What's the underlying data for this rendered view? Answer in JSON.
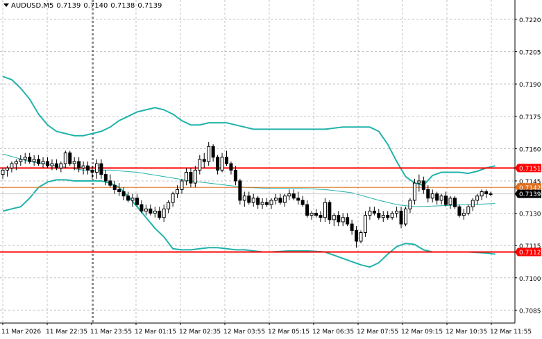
{
  "header": {
    "symbol": "AUDUSD,M5",
    "open": "0.7139",
    "high": "0.7140",
    "low": "0.7138",
    "close": "0.7139"
  },
  "colors": {
    "background": "#ffffff",
    "grid": "#c0c0c0",
    "candle": "#000000",
    "bands": "#20b2aa",
    "ma": "#20b2aa",
    "level_line": "#ff0000",
    "bid_line": "#e07020",
    "price_label": "#000000",
    "level_label": "#ff0000"
  },
  "chart_data": {
    "type": "candlestick",
    "y_ticks": [
      "0.7220",
      "0.7205",
      "0.7190",
      "0.7175",
      "0.7160",
      "0.7145",
      "0.7130",
      "0.7115",
      "0.7100",
      "0.7085"
    ],
    "x_ticks": [
      "11 Mar 2026",
      "11 Mar 22:35",
      "11 Mar 23:55",
      "12 Mar 01:15",
      "12 Mar 02:35",
      "12 Mar 03:55",
      "12 Mar 05:15",
      "12 Mar 06:35",
      "12 Mar 07:55",
      "12 Mar 09:15",
      "12 Mar 10:35",
      "12 Mar 11:55"
    ],
    "ylim": [
      0.7079,
      0.7229
    ],
    "levels": [
      {
        "value": 0.7151,
        "label": "0.7151"
      },
      {
        "value": 0.7112,
        "label": "0.7112"
      }
    ],
    "bid": {
      "value": 0.7142,
      "label": "0.7142"
    },
    "last_price": {
      "value": 0.7139,
      "label": "0.7139"
    },
    "grid": true,
    "period_separator": true,
    "bands_upper": [
      [
        0,
        0.71935
      ],
      [
        2,
        0.7192
      ],
      [
        4,
        0.7188
      ],
      [
        6,
        0.7183
      ],
      [
        8,
        0.7176
      ],
      [
        10,
        0.7171
      ],
      [
        12,
        0.7168
      ],
      [
        14,
        0.7167
      ],
      [
        16,
        0.7166
      ],
      [
        18,
        0.7166
      ],
      [
        20,
        0.7167
      ],
      [
        22,
        0.7168
      ],
      [
        24,
        0.717
      ],
      [
        26,
        0.7173
      ],
      [
        28,
        0.7175
      ],
      [
        30,
        0.7177
      ],
      [
        32,
        0.7178
      ],
      [
        34,
        0.7179
      ],
      [
        36,
        0.7178
      ],
      [
        38,
        0.7176
      ],
      [
        40,
        0.7173
      ],
      [
        42,
        0.7171
      ],
      [
        44,
        0.7171
      ],
      [
        46,
        0.7172
      ],
      [
        48,
        0.7172
      ],
      [
        50,
        0.7172
      ],
      [
        52,
        0.7171
      ],
      [
        54,
        0.717
      ],
      [
        56,
        0.7169
      ],
      [
        58,
        0.7169
      ],
      [
        60,
        0.7169
      ],
      [
        64,
        0.7169
      ],
      [
        68,
        0.7169
      ],
      [
        72,
        0.7169
      ],
      [
        76,
        0.717
      ],
      [
        80,
        0.717
      ],
      [
        82,
        0.717
      ],
      [
        84,
        0.7168
      ],
      [
        86,
        0.7162
      ],
      [
        88,
        0.7154
      ],
      [
        90,
        0.7147
      ],
      [
        92,
        0.7144
      ],
      [
        94,
        0.7143
      ],
      [
        96,
        0.71475
      ],
      [
        98,
        0.7149
      ],
      [
        100,
        0.7149
      ],
      [
        102,
        0.7149
      ],
      [
        104,
        0.71485
      ],
      [
        106,
        0.71495
      ],
      [
        108,
        0.7151
      ],
      [
        110,
        0.7152
      ]
    ],
    "bands_lower": [
      [
        0,
        0.7131
      ],
      [
        2,
        0.7132
      ],
      [
        4,
        0.7133
      ],
      [
        6,
        0.7137
      ],
      [
        8,
        0.7142
      ],
      [
        10,
        0.71445
      ],
      [
        12,
        0.71455
      ],
      [
        14,
        0.71455
      ],
      [
        16,
        0.7145
      ],
      [
        18,
        0.7145
      ],
      [
        20,
        0.7145
      ],
      [
        22,
        0.7145
      ],
      [
        24,
        0.7144
      ],
      [
        26,
        0.7142
      ],
      [
        28,
        0.7138
      ],
      [
        30,
        0.7133
      ],
      [
        32,
        0.7128
      ],
      [
        34,
        0.7123
      ],
      [
        36,
        0.7119
      ],
      [
        38,
        0.71135
      ],
      [
        40,
        0.7113
      ],
      [
        42,
        0.7113
      ],
      [
        44,
        0.71135
      ],
      [
        46,
        0.7114
      ],
      [
        48,
        0.7114
      ],
      [
        50,
        0.71135
      ],
      [
        52,
        0.7113
      ],
      [
        54,
        0.7113
      ],
      [
        56,
        0.71125
      ],
      [
        58,
        0.7112
      ],
      [
        60,
        0.7112
      ],
      [
        64,
        0.71125
      ],
      [
        68,
        0.71125
      ],
      [
        72,
        0.7112
      ],
      [
        76,
        0.7109
      ],
      [
        80,
        0.7106
      ],
      [
        82,
        0.7105
      ],
      [
        84,
        0.7107
      ],
      [
        86,
        0.7111
      ],
      [
        88,
        0.71145
      ],
      [
        90,
        0.7116
      ],
      [
        92,
        0.71155
      ],
      [
        94,
        0.7113
      ],
      [
        96,
        0.7112
      ],
      [
        100,
        0.7112
      ],
      [
        104,
        0.7112
      ],
      [
        108,
        0.71115
      ],
      [
        110,
        0.7111
      ]
    ],
    "ma": [
      [
        0,
        0.71575
      ],
      [
        6,
        0.7154
      ],
      [
        12,
        0.7152
      ],
      [
        18,
        0.715
      ],
      [
        24,
        0.715
      ],
      [
        30,
        0.7149
      ],
      [
        36,
        0.7147
      ],
      [
        42,
        0.7145
      ],
      [
        48,
        0.71435
      ],
      [
        54,
        0.7142
      ],
      [
        60,
        0.71415
      ],
      [
        66,
        0.71415
      ],
      [
        72,
        0.7141
      ],
      [
        78,
        0.71395
      ],
      [
        84,
        0.7136
      ],
      [
        88,
        0.7134
      ],
      [
        92,
        0.7133
      ],
      [
        98,
        0.71335
      ],
      [
        104,
        0.7134
      ],
      [
        110,
        0.71345
      ]
    ],
    "candles": [
      [
        0,
        0.7148,
        0.7151,
        0.7146,
        0.715
      ],
      [
        1,
        0.715,
        0.7152,
        0.7147,
        0.7151
      ],
      [
        2,
        0.7151,
        0.7154,
        0.7149,
        0.7153
      ],
      [
        3,
        0.7153,
        0.7155,
        0.715,
        0.7154
      ],
      [
        4,
        0.7154,
        0.7157,
        0.7152,
        0.7155
      ],
      [
        5,
        0.7155,
        0.7158,
        0.7153,
        0.7156
      ],
      [
        6,
        0.7156,
        0.7158,
        0.7153,
        0.7154
      ],
      [
        7,
        0.7154,
        0.7157,
        0.7152,
        0.7155
      ],
      [
        8,
        0.7155,
        0.7157,
        0.7152,
        0.7153
      ],
      [
        9,
        0.7153,
        0.7156,
        0.7151,
        0.7154
      ],
      [
        10,
        0.7154,
        0.7156,
        0.7151,
        0.7152
      ],
      [
        11,
        0.7152,
        0.7155,
        0.715,
        0.7153
      ],
      [
        12,
        0.7153,
        0.7155,
        0.715,
        0.7151
      ],
      [
        13,
        0.7151,
        0.7154,
        0.7149,
        0.7153
      ],
      [
        14,
        0.7153,
        0.7159,
        0.7151,
        0.7158
      ],
      [
        15,
        0.7158,
        0.7159,
        0.7152,
        0.7153
      ],
      [
        16,
        0.7153,
        0.7156,
        0.715,
        0.7154
      ],
      [
        17,
        0.7154,
        0.7156,
        0.7149,
        0.7151
      ],
      [
        18,
        0.7151,
        0.7154,
        0.7148,
        0.7152
      ],
      [
        19,
        0.7152,
        0.7154,
        0.7148,
        0.715
      ],
      [
        20,
        0.715,
        0.7152,
        0.7146,
        0.7149
      ],
      [
        21,
        0.7149,
        0.7155,
        0.7146,
        0.7153
      ],
      [
        22,
        0.7153,
        0.7155,
        0.7146,
        0.7148
      ],
      [
        23,
        0.7148,
        0.715,
        0.7143,
        0.7145
      ],
      [
        24,
        0.7145,
        0.7148,
        0.7142,
        0.7143
      ],
      [
        25,
        0.7143,
        0.7145,
        0.7139,
        0.7141
      ],
      [
        26,
        0.7141,
        0.7144,
        0.7138,
        0.714
      ],
      [
        27,
        0.714,
        0.7142,
        0.7136,
        0.7138
      ],
      [
        28,
        0.7138,
        0.714,
        0.7135,
        0.7136
      ],
      [
        29,
        0.7136,
        0.7139,
        0.7133,
        0.7137
      ],
      [
        30,
        0.7137,
        0.7139,
        0.7133,
        0.7134
      ],
      [
        31,
        0.7134,
        0.7136,
        0.713,
        0.7131
      ],
      [
        32,
        0.7131,
        0.7134,
        0.7129,
        0.7132
      ],
      [
        33,
        0.7132,
        0.7134,
        0.7129,
        0.713
      ],
      [
        34,
        0.713,
        0.7133,
        0.7128,
        0.7131
      ],
      [
        35,
        0.7131,
        0.7133,
        0.7127,
        0.7128
      ],
      [
        36,
        0.7128,
        0.7134,
        0.7126,
        0.7132
      ],
      [
        37,
        0.7132,
        0.7136,
        0.713,
        0.7135
      ],
      [
        38,
        0.7135,
        0.714,
        0.7133,
        0.7139
      ],
      [
        39,
        0.7139,
        0.7143,
        0.7137,
        0.7141
      ],
      [
        40,
        0.7141,
        0.7146,
        0.7139,
        0.7145
      ],
      [
        41,
        0.7145,
        0.7151,
        0.7143,
        0.7149
      ],
      [
        42,
        0.7149,
        0.7151,
        0.7142,
        0.7144
      ],
      [
        43,
        0.7144,
        0.7152,
        0.7142,
        0.715
      ],
      [
        44,
        0.715,
        0.7157,
        0.7148,
        0.7155
      ],
      [
        45,
        0.7155,
        0.7158,
        0.7151,
        0.7154
      ],
      [
        46,
        0.7154,
        0.7163,
        0.7152,
        0.7161
      ],
      [
        47,
        0.7161,
        0.7162,
        0.7154,
        0.7156
      ],
      [
        48,
        0.7156,
        0.7157,
        0.7148,
        0.715
      ],
      [
        49,
        0.715,
        0.7158,
        0.7149,
        0.7156
      ],
      [
        50,
        0.7156,
        0.7159,
        0.7152,
        0.7153
      ],
      [
        51,
        0.7153,
        0.7154,
        0.7148,
        0.715
      ],
      [
        52,
        0.715,
        0.7152,
        0.7143,
        0.7145
      ],
      [
        53,
        0.7145,
        0.7146,
        0.7134,
        0.7136
      ],
      [
        54,
        0.7136,
        0.714,
        0.7133,
        0.7138
      ],
      [
        55,
        0.7138,
        0.714,
        0.7134,
        0.7135
      ],
      [
        56,
        0.7135,
        0.7139,
        0.7133,
        0.7137
      ],
      [
        57,
        0.7137,
        0.7138,
        0.7132,
        0.7134
      ],
      [
        58,
        0.7134,
        0.7137,
        0.7132,
        0.7135
      ],
      [
        59,
        0.7135,
        0.7137,
        0.7133,
        0.7134
      ],
      [
        60,
        0.7134,
        0.7137,
        0.7132,
        0.7136
      ],
      [
        61,
        0.7136,
        0.7139,
        0.7134,
        0.7137
      ],
      [
        62,
        0.7137,
        0.7139,
        0.7134,
        0.7135
      ],
      [
        63,
        0.7135,
        0.7139,
        0.7133,
        0.7138
      ],
      [
        64,
        0.7138,
        0.7141,
        0.7136,
        0.7139
      ],
      [
        65,
        0.7139,
        0.7141,
        0.7136,
        0.7137
      ],
      [
        66,
        0.7137,
        0.714,
        0.7134,
        0.7136
      ],
      [
        67,
        0.7136,
        0.7138,
        0.7133,
        0.7134
      ],
      [
        68,
        0.7134,
        0.7136,
        0.7128,
        0.7129
      ],
      [
        69,
        0.7129,
        0.7131,
        0.7127,
        0.713
      ],
      [
        70,
        0.713,
        0.7132,
        0.7128,
        0.7129
      ],
      [
        71,
        0.7129,
        0.7131,
        0.7126,
        0.7128
      ],
      [
        72,
        0.7128,
        0.7137,
        0.7126,
        0.7135
      ],
      [
        73,
        0.7135,
        0.7136,
        0.7125,
        0.7127
      ],
      [
        74,
        0.7127,
        0.713,
        0.7124,
        0.7129
      ],
      [
        75,
        0.7129,
        0.7131,
        0.7124,
        0.7126
      ],
      [
        76,
        0.7126,
        0.713,
        0.7124,
        0.7128
      ],
      [
        77,
        0.7128,
        0.713,
        0.7124,
        0.7125
      ],
      [
        78,
        0.7125,
        0.7127,
        0.712,
        0.7122
      ],
      [
        79,
        0.7122,
        0.7124,
        0.7114,
        0.7117
      ],
      [
        80,
        0.7117,
        0.7122,
        0.7116,
        0.7121
      ],
      [
        81,
        0.7121,
        0.7131,
        0.7119,
        0.7129
      ],
      [
        82,
        0.7129,
        0.7133,
        0.7127,
        0.7131
      ],
      [
        83,
        0.7131,
        0.7133,
        0.7129,
        0.713
      ],
      [
        84,
        0.713,
        0.7132,
        0.7127,
        0.7128
      ],
      [
        85,
        0.7128,
        0.7131,
        0.7126,
        0.7129
      ],
      [
        86,
        0.7129,
        0.7131,
        0.7127,
        0.7128
      ],
      [
        87,
        0.7128,
        0.7131,
        0.7127,
        0.713
      ],
      [
        88,
        0.713,
        0.7133,
        0.7128,
        0.7131
      ],
      [
        89,
        0.7131,
        0.7133,
        0.7123,
        0.7125
      ],
      [
        90,
        0.7125,
        0.7133,
        0.7124,
        0.7132
      ],
      [
        91,
        0.7132,
        0.7137,
        0.713,
        0.7136
      ],
      [
        92,
        0.7136,
        0.7146,
        0.7134,
        0.7144
      ],
      [
        93,
        0.7144,
        0.7148,
        0.714,
        0.7145
      ],
      [
        94,
        0.7145,
        0.7147,
        0.7139,
        0.7141
      ],
      [
        95,
        0.7141,
        0.7143,
        0.7135,
        0.7137
      ],
      [
        96,
        0.7137,
        0.7141,
        0.7135,
        0.7139
      ],
      [
        97,
        0.7139,
        0.714,
        0.7134,
        0.7136
      ],
      [
        98,
        0.7136,
        0.7139,
        0.7134,
        0.7138
      ],
      [
        99,
        0.7138,
        0.714,
        0.7133,
        0.7134
      ],
      [
        100,
        0.7134,
        0.7138,
        0.7132,
        0.7137
      ],
      [
        101,
        0.7137,
        0.7138,
        0.7132,
        0.7133
      ],
      [
        102,
        0.7133,
        0.7134,
        0.7128,
        0.7129
      ],
      [
        103,
        0.7129,
        0.7132,
        0.7127,
        0.713
      ],
      [
        104,
        0.713,
        0.7134,
        0.7129,
        0.7133
      ],
      [
        105,
        0.7133,
        0.7137,
        0.7131,
        0.7136
      ],
      [
        106,
        0.7136,
        0.7139,
        0.7134,
        0.7138
      ],
      [
        107,
        0.7138,
        0.7141,
        0.7136,
        0.714
      ],
      [
        108,
        0.714,
        0.7141,
        0.7137,
        0.7139
      ],
      [
        109,
        0.7139,
        0.714,
        0.7138,
        0.7139
      ]
    ]
  }
}
